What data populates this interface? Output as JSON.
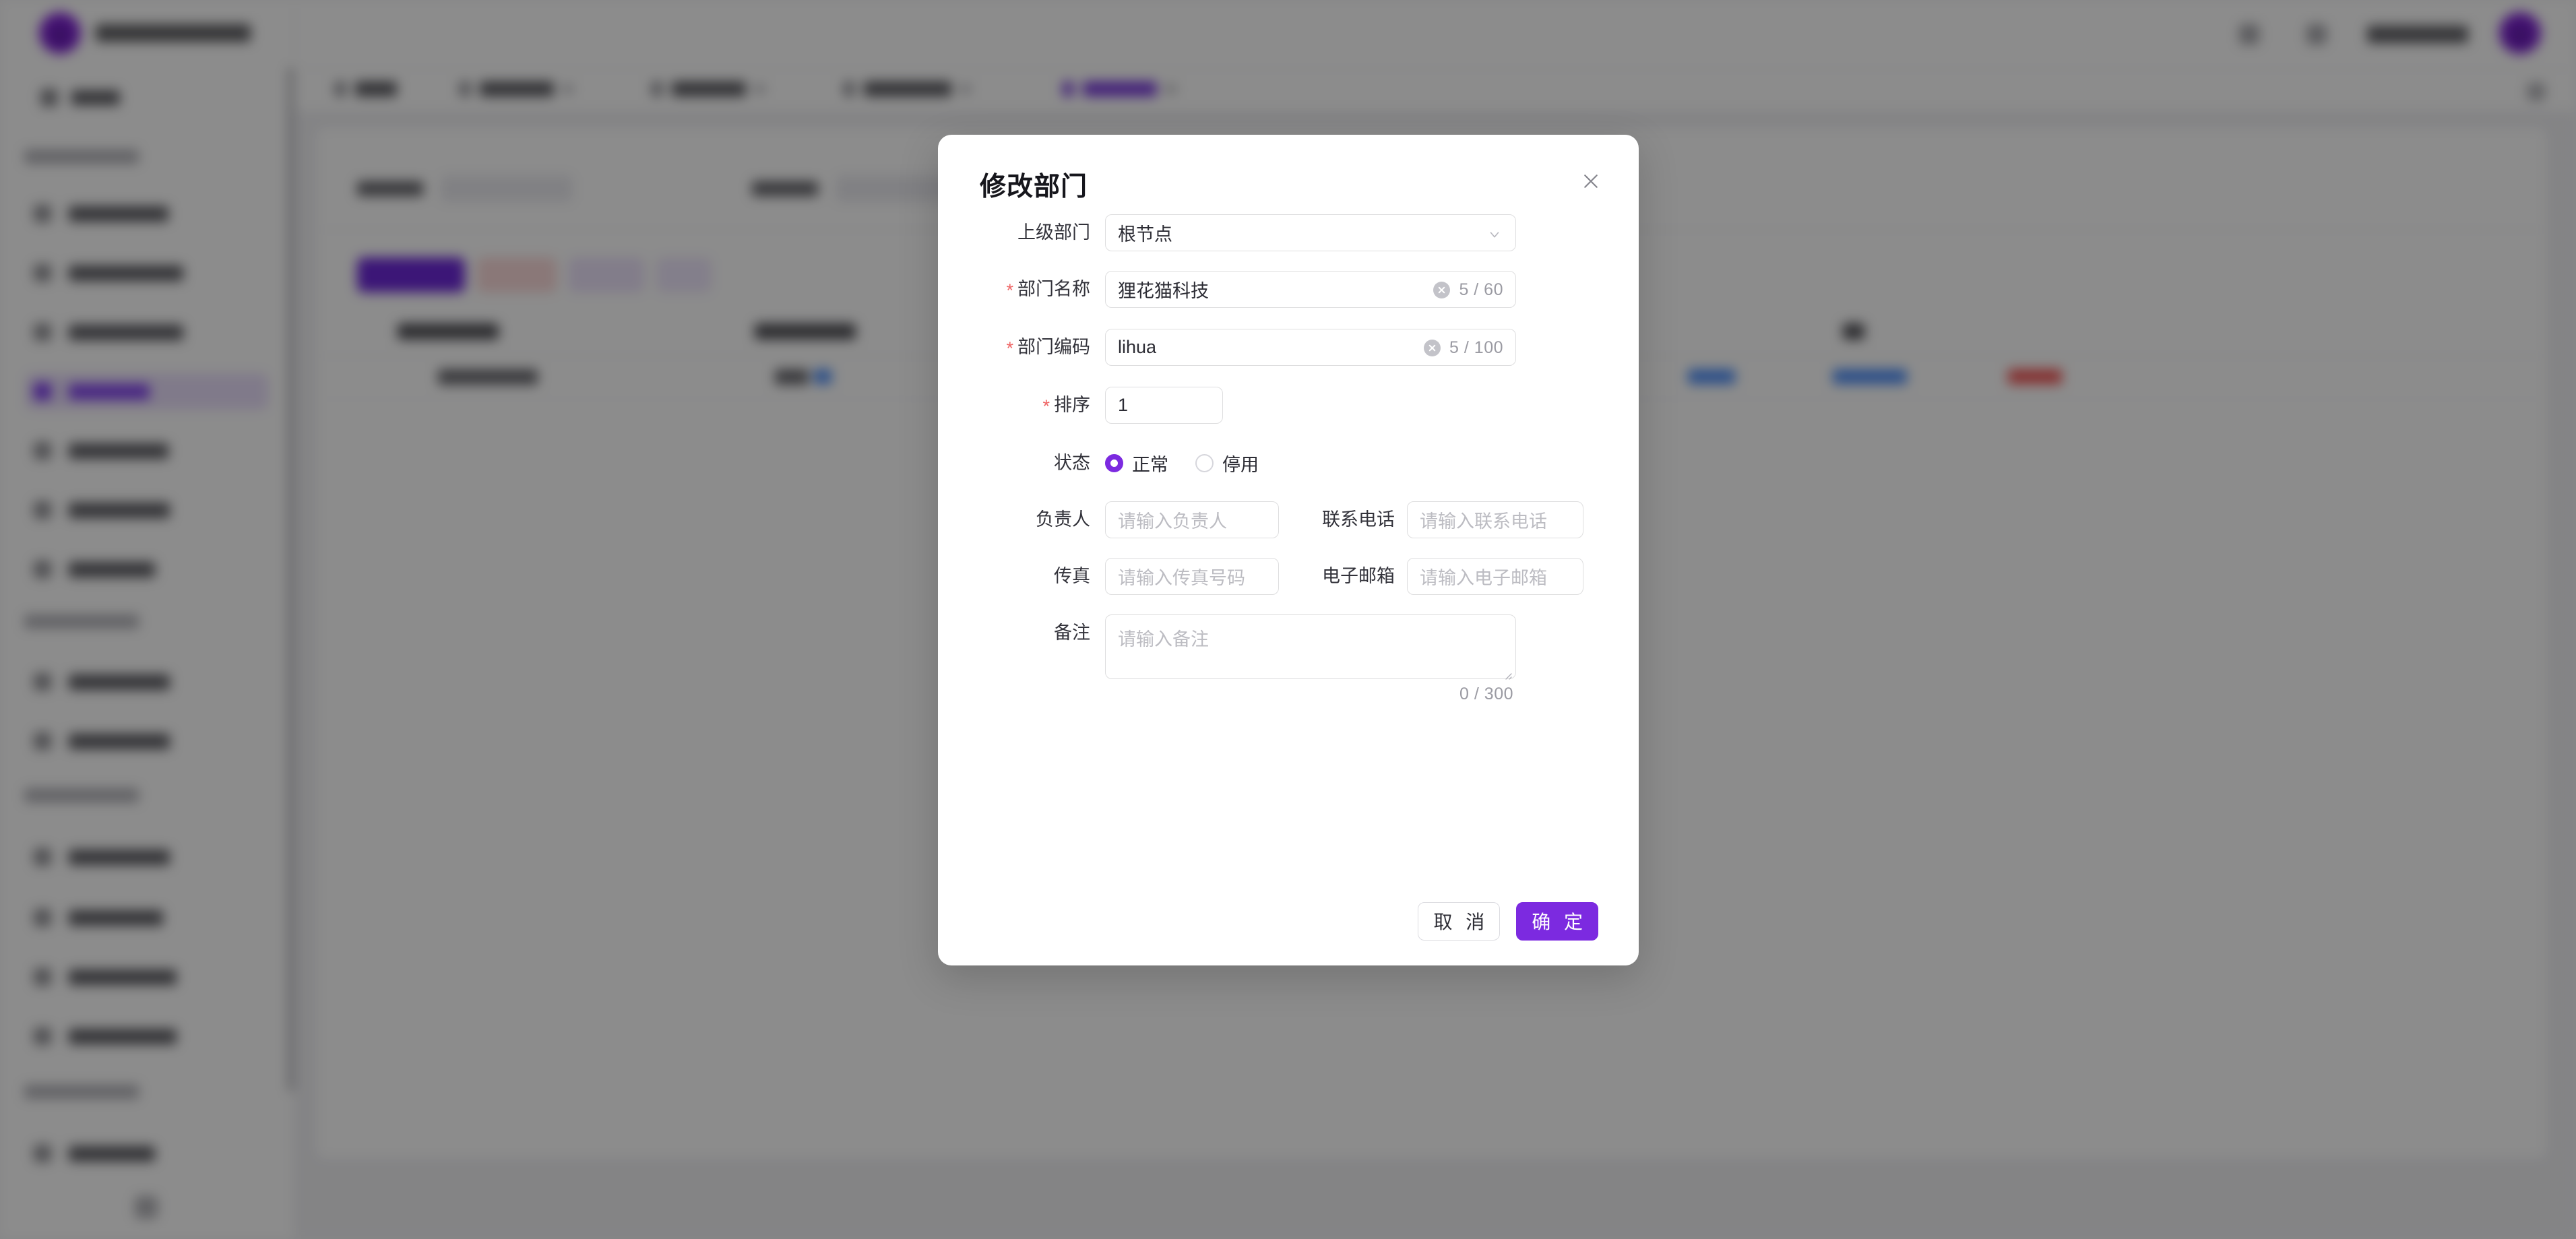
{
  "app": {
    "brand_name_redacted": true,
    "accent_color": "#7c2ae0",
    "overlay_color": "#888888"
  },
  "modal": {
    "title": "修改部门",
    "close_icon": "close-icon",
    "fields": {
      "parent_dept": {
        "label": "上级部门",
        "required": false,
        "type": "select",
        "value": "根节点",
        "chevron_icon": "chevron-down-icon"
      },
      "dept_name": {
        "label": "部门名称",
        "required": true,
        "required_marker": "*",
        "type": "text",
        "value": "狸花猫科技",
        "clear_icon": "clear-circle-icon",
        "counter": "5 / 60",
        "max_length": 60
      },
      "dept_code": {
        "label": "部门编码",
        "required": true,
        "required_marker": "*",
        "type": "text",
        "value": "lihua",
        "clear_icon": "clear-circle-icon",
        "counter": "5 / 100",
        "max_length": 100
      },
      "sort_order": {
        "label": "排序",
        "required": true,
        "required_marker": "*",
        "type": "number",
        "value": "1"
      },
      "status": {
        "label": "状态",
        "required": false,
        "type": "radio",
        "options": [
          {
            "label": "正常",
            "checked": true
          },
          {
            "label": "停用",
            "checked": false
          }
        ]
      },
      "leader": {
        "label": "负责人",
        "required": false,
        "type": "text",
        "value": "",
        "placeholder": "请输入负责人"
      },
      "phone": {
        "label": "联系电话",
        "required": false,
        "type": "text",
        "value": "",
        "placeholder": "请输入联系电话"
      },
      "fax": {
        "label": "传真",
        "required": false,
        "type": "text",
        "value": "",
        "placeholder": "请输入传真号码"
      },
      "email": {
        "label": "电子邮箱",
        "required": false,
        "type": "text",
        "value": "",
        "placeholder": "请输入电子邮箱"
      },
      "remark": {
        "label": "备注",
        "required": false,
        "type": "textarea",
        "value": "",
        "placeholder": "请输入备注",
        "counter": "0 / 300",
        "max_length": 300,
        "resize_handle_icon": "resize-handle-icon"
      }
    },
    "footer": {
      "cancel_label": "取 消",
      "confirm_label": "确 定"
    }
  },
  "background": {
    "note": "Application behind the modal is blurred by the overlay; text is not legible.",
    "sidebar": {
      "groups": 4,
      "active_item_index": 4
    }
  }
}
